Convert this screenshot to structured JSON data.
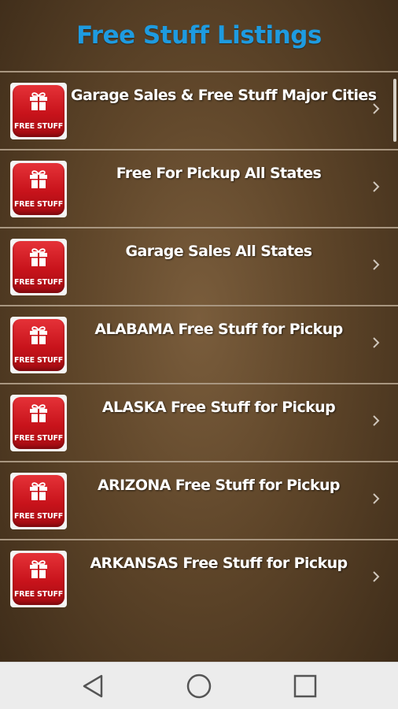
{
  "header": {
    "title": "Free Stuff Listings"
  },
  "icon_badge_text": "FREE STUFF",
  "colors": {
    "title": "#1e9be0",
    "icon_red": "#d2161d",
    "divider": "#a89680"
  },
  "items": [
    {
      "label": "Garage Sales & Free Stuff Major Cities"
    },
    {
      "label": "Free For Pickup All States"
    },
    {
      "label": "Garage Sales All States"
    },
    {
      "label": "ALABAMA Free Stuff for Pickup"
    },
    {
      "label": "ALASKA Free Stuff for Pickup"
    },
    {
      "label": "ARIZONA Free Stuff for Pickup"
    },
    {
      "label": "ARKANSAS Free Stuff for Pickup"
    }
  ],
  "navbar": {
    "icons": [
      "back-triangle-icon",
      "home-circle-icon",
      "recents-square-icon"
    ]
  }
}
